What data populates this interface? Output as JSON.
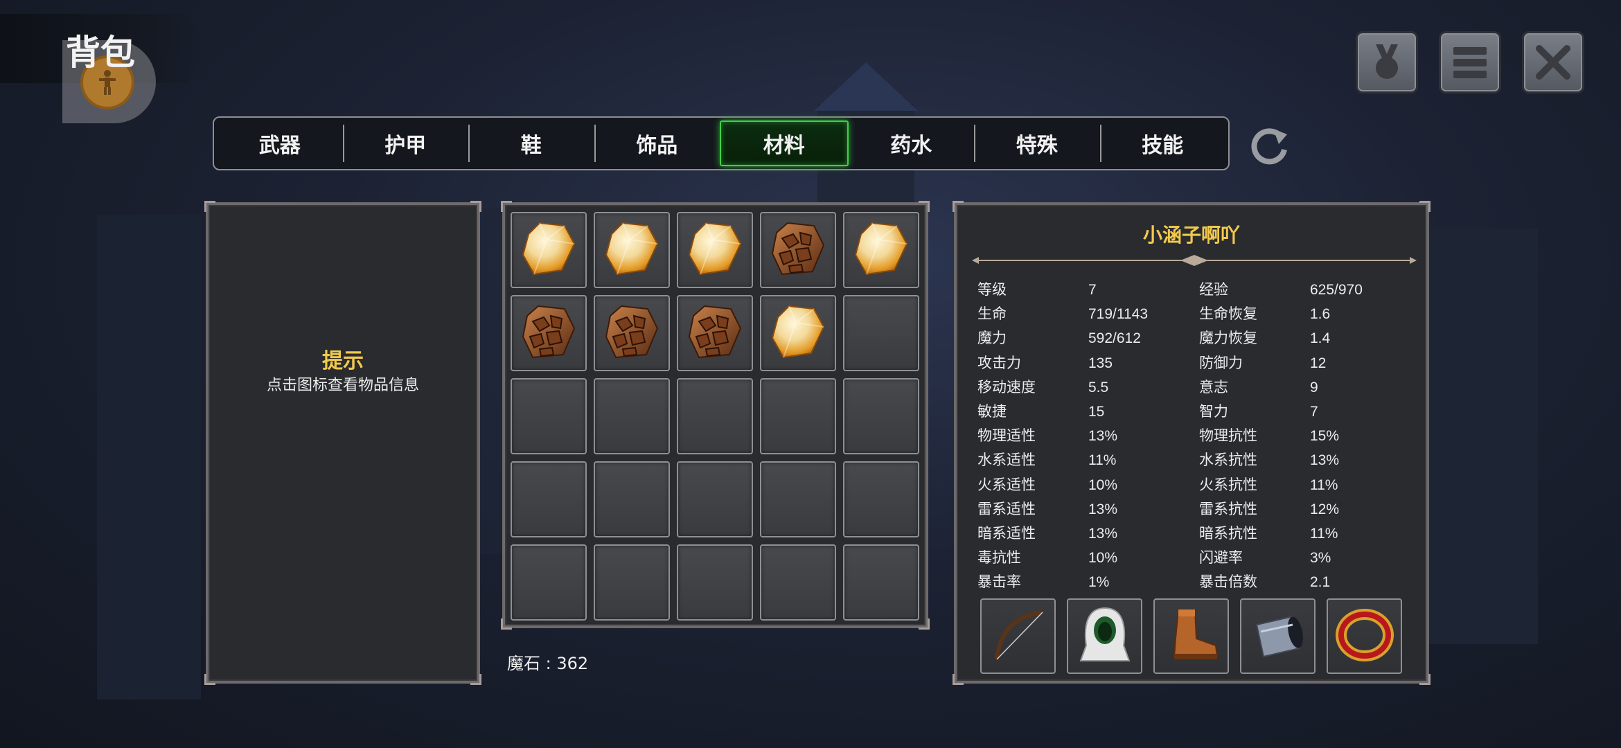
{
  "header": {
    "title": "背包"
  },
  "tabs": [
    {
      "label": "武器",
      "active": false
    },
    {
      "label": "护甲",
      "active": false
    },
    {
      "label": "鞋",
      "active": false
    },
    {
      "label": "饰品",
      "active": false
    },
    {
      "label": "材料",
      "active": true
    },
    {
      "label": "药水",
      "active": false
    },
    {
      "label": "特殊",
      "active": false
    },
    {
      "label": "技能",
      "active": false
    }
  ],
  "hint": {
    "title": "提示",
    "text": "点击图标查看物品信息"
  },
  "inventory": {
    "slots": [
      "crystal-icon",
      "crystal-icon",
      "crystal-icon",
      "ore-icon",
      "crystal-icon",
      "ore-icon",
      "ore-icon",
      "ore-icon",
      "crystal-icon",
      "",
      "",
      "",
      "",
      "",
      "",
      "",
      "",
      "",
      "",
      "",
      "",
      "",
      "",
      "",
      ""
    ],
    "magic_stone": "魔石 : 362"
  },
  "character": {
    "name": "小涵子啊吖",
    "stats": [
      {
        "label": "等级",
        "value": "7",
        "label2": "经验",
        "value2": "625/970"
      },
      {
        "label": "生命",
        "value": "719/1143",
        "label2": "生命恢复",
        "value2": "1.6"
      },
      {
        "label": "魔力",
        "value": "592/612",
        "label2": "魔力恢复",
        "value2": "1.4"
      },
      {
        "label": "攻击力",
        "value": "135",
        "label2": "防御力",
        "value2": "12"
      },
      {
        "label": "移动速度",
        "value": "5.5",
        "label2": "意志",
        "value2": "9"
      },
      {
        "label": "敏捷",
        "value": "15",
        "label2": "智力",
        "value2": "7"
      },
      {
        "label": "物理适性",
        "value": "13%",
        "label2": "物理抗性",
        "value2": "15%"
      },
      {
        "label": "水系适性",
        "value": "11%",
        "label2": "水系抗性",
        "value2": "13%"
      },
      {
        "label": "火系适性",
        "value": "10%",
        "label2": "火系抗性",
        "value2": "11%"
      },
      {
        "label": "雷系适性",
        "value": "13%",
        "label2": "雷系抗性",
        "value2": "12%"
      },
      {
        "label": "暗系适性",
        "value": "13%",
        "label2": "暗系抗性",
        "value2": "11%"
      },
      {
        "label": "毒抗性",
        "value": "10%",
        "label2": "闪避率",
        "value2": "3%"
      },
      {
        "label": "暴击率",
        "value": "1%",
        "label2": "暴击倍数",
        "value2": "2.1"
      }
    ],
    "equipment": [
      "bow-icon",
      "hood-icon",
      "boots-icon",
      "bracer-icon",
      "ring-icon"
    ]
  },
  "colors": {
    "accent_gold": "#f2c94c",
    "active_tab_green": "#3fd04a"
  }
}
